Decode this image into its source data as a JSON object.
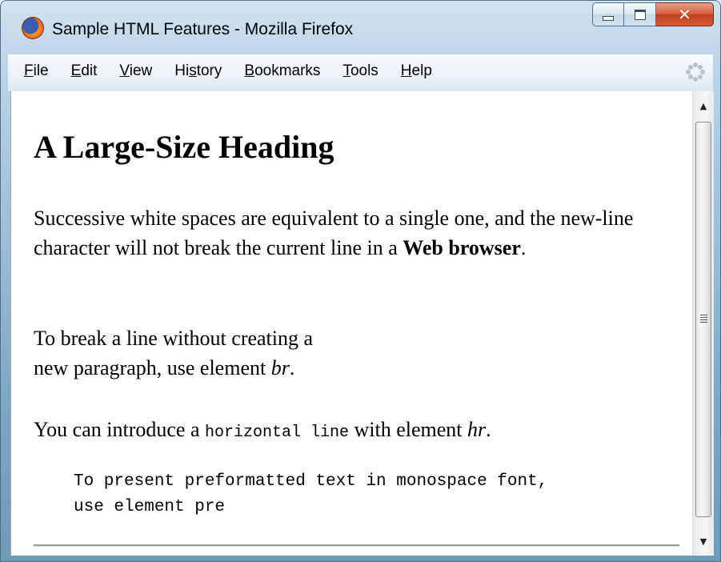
{
  "window": {
    "title": "Sample HTML Features - Mozilla Firefox"
  },
  "menubar": {
    "items": [
      {
        "label": "File",
        "accel": "F",
        "rest": "ile"
      },
      {
        "label": "Edit",
        "accel": "E",
        "rest": "dit"
      },
      {
        "label": "View",
        "accel": "V",
        "rest": "iew"
      },
      {
        "label": "History",
        "pre": "Hi",
        "accel": "s",
        "rest": "tory"
      },
      {
        "label": "Bookmarks",
        "accel": "B",
        "rest": "ookmarks"
      },
      {
        "label": "Tools",
        "accel": "T",
        "rest": "ools"
      },
      {
        "label": "Help",
        "accel": "H",
        "rest": "elp"
      }
    ]
  },
  "page": {
    "heading": "A Large-Size Heading",
    "p1_text": "Successive white spaces are equivalent to a single one, and the new-line character will not break the current line in a ",
    "p1_bold": "Web browser",
    "p1_end": ".",
    "p2_line1": "To break a line without creating a",
    "p2_line2": "new paragraph, use element ",
    "p2_em": "br",
    "p2_end": ".",
    "p3_text": "You can introduce a ",
    "p3_code": "horizontal line",
    "p3_mid": " with element ",
    "p3_em": "hr",
    "p3_end": ".",
    "pre_text": "To present preformatted text in monospace font,\nuse element pre"
  },
  "icons": {
    "app": "firefox-logo-icon",
    "minimize": "minimize-icon",
    "maximize": "maximize-icon",
    "close": "close-icon",
    "throbber": "activity-throbber-icon",
    "scroll_up": "scroll-up-arrow-icon",
    "scroll_down": "scroll-down-arrow-icon"
  }
}
